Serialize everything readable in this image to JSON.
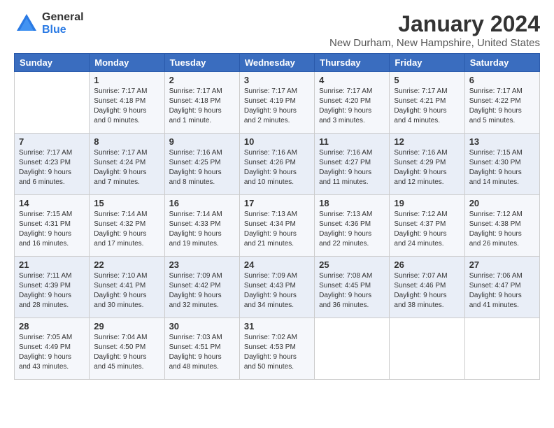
{
  "logo": {
    "general": "General",
    "blue": "Blue"
  },
  "title": "January 2024",
  "subtitle": "New Durham, New Hampshire, United States",
  "weekdays": [
    "Sunday",
    "Monday",
    "Tuesday",
    "Wednesday",
    "Thursday",
    "Friday",
    "Saturday"
  ],
  "weeks": [
    [
      {
        "day": "",
        "sunrise": "",
        "sunset": "",
        "daylight": ""
      },
      {
        "day": "1",
        "sunrise": "Sunrise: 7:17 AM",
        "sunset": "Sunset: 4:18 PM",
        "daylight": "Daylight: 9 hours and 0 minutes."
      },
      {
        "day": "2",
        "sunrise": "Sunrise: 7:17 AM",
        "sunset": "Sunset: 4:18 PM",
        "daylight": "Daylight: 9 hours and 1 minute."
      },
      {
        "day": "3",
        "sunrise": "Sunrise: 7:17 AM",
        "sunset": "Sunset: 4:19 PM",
        "daylight": "Daylight: 9 hours and 2 minutes."
      },
      {
        "day": "4",
        "sunrise": "Sunrise: 7:17 AM",
        "sunset": "Sunset: 4:20 PM",
        "daylight": "Daylight: 9 hours and 3 minutes."
      },
      {
        "day": "5",
        "sunrise": "Sunrise: 7:17 AM",
        "sunset": "Sunset: 4:21 PM",
        "daylight": "Daylight: 9 hours and 4 minutes."
      },
      {
        "day": "6",
        "sunrise": "Sunrise: 7:17 AM",
        "sunset": "Sunset: 4:22 PM",
        "daylight": "Daylight: 9 hours and 5 minutes."
      }
    ],
    [
      {
        "day": "7",
        "sunrise": "Sunrise: 7:17 AM",
        "sunset": "Sunset: 4:23 PM",
        "daylight": "Daylight: 9 hours and 6 minutes."
      },
      {
        "day": "8",
        "sunrise": "Sunrise: 7:17 AM",
        "sunset": "Sunset: 4:24 PM",
        "daylight": "Daylight: 9 hours and 7 minutes."
      },
      {
        "day": "9",
        "sunrise": "Sunrise: 7:16 AM",
        "sunset": "Sunset: 4:25 PM",
        "daylight": "Daylight: 9 hours and 8 minutes."
      },
      {
        "day": "10",
        "sunrise": "Sunrise: 7:16 AM",
        "sunset": "Sunset: 4:26 PM",
        "daylight": "Daylight: 9 hours and 10 minutes."
      },
      {
        "day": "11",
        "sunrise": "Sunrise: 7:16 AM",
        "sunset": "Sunset: 4:27 PM",
        "daylight": "Daylight: 9 hours and 11 minutes."
      },
      {
        "day": "12",
        "sunrise": "Sunrise: 7:16 AM",
        "sunset": "Sunset: 4:29 PM",
        "daylight": "Daylight: 9 hours and 12 minutes."
      },
      {
        "day": "13",
        "sunrise": "Sunrise: 7:15 AM",
        "sunset": "Sunset: 4:30 PM",
        "daylight": "Daylight: 9 hours and 14 minutes."
      }
    ],
    [
      {
        "day": "14",
        "sunrise": "Sunrise: 7:15 AM",
        "sunset": "Sunset: 4:31 PM",
        "daylight": "Daylight: 9 hours and 16 minutes."
      },
      {
        "day": "15",
        "sunrise": "Sunrise: 7:14 AM",
        "sunset": "Sunset: 4:32 PM",
        "daylight": "Daylight: 9 hours and 17 minutes."
      },
      {
        "day": "16",
        "sunrise": "Sunrise: 7:14 AM",
        "sunset": "Sunset: 4:33 PM",
        "daylight": "Daylight: 9 hours and 19 minutes."
      },
      {
        "day": "17",
        "sunrise": "Sunrise: 7:13 AM",
        "sunset": "Sunset: 4:34 PM",
        "daylight": "Daylight: 9 hours and 21 minutes."
      },
      {
        "day": "18",
        "sunrise": "Sunrise: 7:13 AM",
        "sunset": "Sunset: 4:36 PM",
        "daylight": "Daylight: 9 hours and 22 minutes."
      },
      {
        "day": "19",
        "sunrise": "Sunrise: 7:12 AM",
        "sunset": "Sunset: 4:37 PM",
        "daylight": "Daylight: 9 hours and 24 minutes."
      },
      {
        "day": "20",
        "sunrise": "Sunrise: 7:12 AM",
        "sunset": "Sunset: 4:38 PM",
        "daylight": "Daylight: 9 hours and 26 minutes."
      }
    ],
    [
      {
        "day": "21",
        "sunrise": "Sunrise: 7:11 AM",
        "sunset": "Sunset: 4:39 PM",
        "daylight": "Daylight: 9 hours and 28 minutes."
      },
      {
        "day": "22",
        "sunrise": "Sunrise: 7:10 AM",
        "sunset": "Sunset: 4:41 PM",
        "daylight": "Daylight: 9 hours and 30 minutes."
      },
      {
        "day": "23",
        "sunrise": "Sunrise: 7:09 AM",
        "sunset": "Sunset: 4:42 PM",
        "daylight": "Daylight: 9 hours and 32 minutes."
      },
      {
        "day": "24",
        "sunrise": "Sunrise: 7:09 AM",
        "sunset": "Sunset: 4:43 PM",
        "daylight": "Daylight: 9 hours and 34 minutes."
      },
      {
        "day": "25",
        "sunrise": "Sunrise: 7:08 AM",
        "sunset": "Sunset: 4:45 PM",
        "daylight": "Daylight: 9 hours and 36 minutes."
      },
      {
        "day": "26",
        "sunrise": "Sunrise: 7:07 AM",
        "sunset": "Sunset: 4:46 PM",
        "daylight": "Daylight: 9 hours and 38 minutes."
      },
      {
        "day": "27",
        "sunrise": "Sunrise: 7:06 AM",
        "sunset": "Sunset: 4:47 PM",
        "daylight": "Daylight: 9 hours and 41 minutes."
      }
    ],
    [
      {
        "day": "28",
        "sunrise": "Sunrise: 7:05 AM",
        "sunset": "Sunset: 4:49 PM",
        "daylight": "Daylight: 9 hours and 43 minutes."
      },
      {
        "day": "29",
        "sunrise": "Sunrise: 7:04 AM",
        "sunset": "Sunset: 4:50 PM",
        "daylight": "Daylight: 9 hours and 45 minutes."
      },
      {
        "day": "30",
        "sunrise": "Sunrise: 7:03 AM",
        "sunset": "Sunset: 4:51 PM",
        "daylight": "Daylight: 9 hours and 48 minutes."
      },
      {
        "day": "31",
        "sunrise": "Sunrise: 7:02 AM",
        "sunset": "Sunset: 4:53 PM",
        "daylight": "Daylight: 9 hours and 50 minutes."
      },
      {
        "day": "",
        "sunrise": "",
        "sunset": "",
        "daylight": ""
      },
      {
        "day": "",
        "sunrise": "",
        "sunset": "",
        "daylight": ""
      },
      {
        "day": "",
        "sunrise": "",
        "sunset": "",
        "daylight": ""
      }
    ]
  ]
}
